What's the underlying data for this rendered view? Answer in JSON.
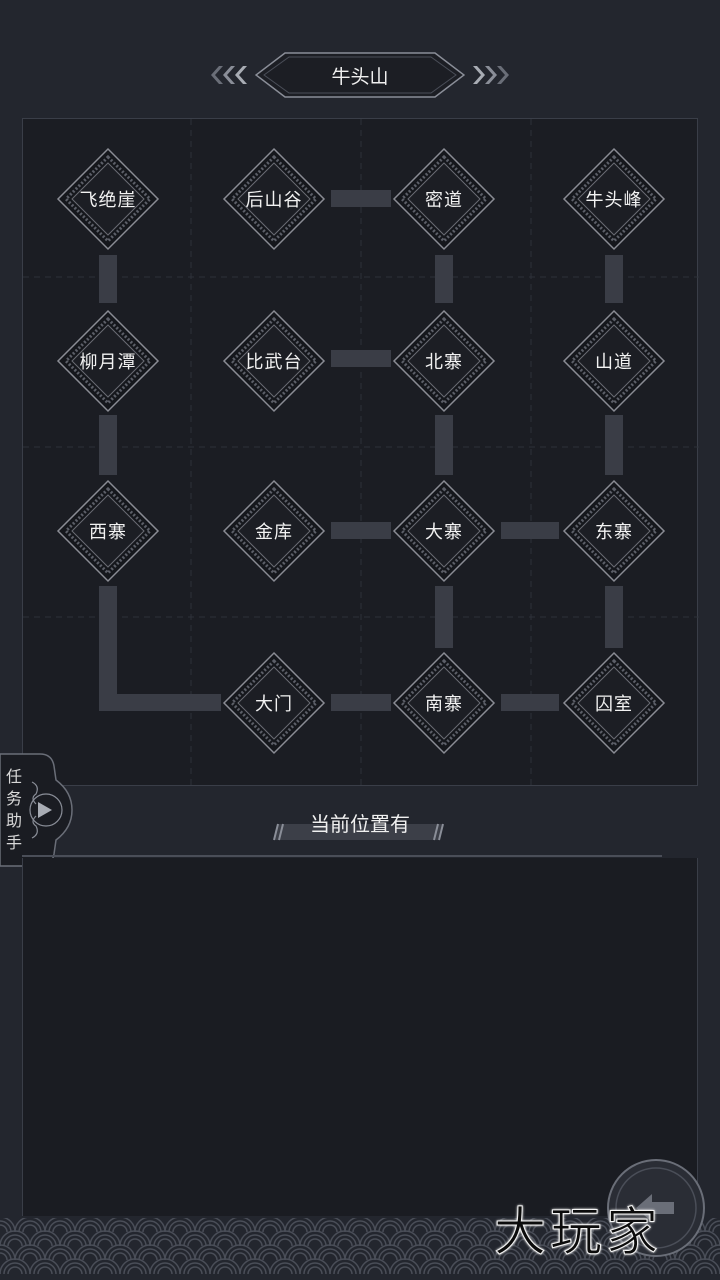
{
  "header": {
    "title": "牛头山"
  },
  "map": {
    "nodes": [
      {
        "id": "feijueya",
        "label": "飞绝崖"
      },
      {
        "id": "houshangu",
        "label": "后山谷"
      },
      {
        "id": "midao",
        "label": "密道"
      },
      {
        "id": "niutoufeng",
        "label": "牛头峰"
      },
      {
        "id": "liuyuetan",
        "label": "柳月潭"
      },
      {
        "id": "biwutai",
        "label": "比武台"
      },
      {
        "id": "beizhai",
        "label": "北寨"
      },
      {
        "id": "shandao",
        "label": "山道"
      },
      {
        "id": "xizhai",
        "label": "西寨"
      },
      {
        "id": "jinku",
        "label": "金库"
      },
      {
        "id": "dazhai",
        "label": "大寨"
      },
      {
        "id": "dongzhai",
        "label": "东寨"
      },
      {
        "id": "damen",
        "label": "大门"
      },
      {
        "id": "nanzhai",
        "label": "南寨"
      },
      {
        "id": "qiushi",
        "label": "囚室"
      }
    ]
  },
  "section": {
    "title": "当前位置有"
  },
  "quest_helper": {
    "label": "任务助手"
  },
  "watermark": {
    "text": "大玩家"
  },
  "colors": {
    "background": "#23262e",
    "panel": "#1b1d23",
    "connector": "#3a3d46",
    "node_border": "#9a9ca4"
  }
}
